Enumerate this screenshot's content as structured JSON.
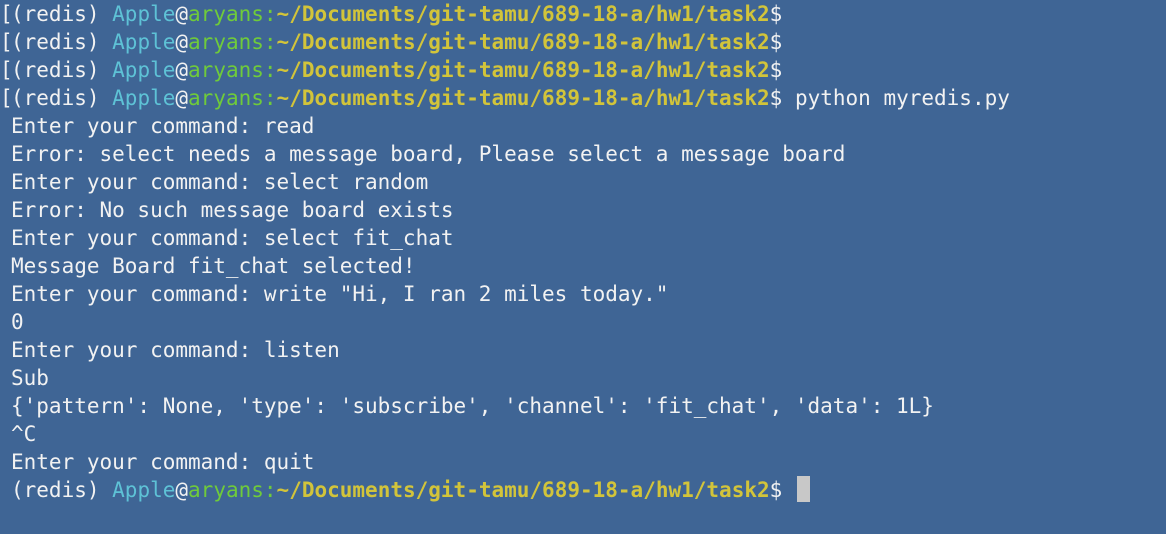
{
  "prompt": {
    "env": "(redis) ",
    "user": "Apple",
    "at": "@",
    "host": "aryans",
    "colon": ":",
    "path": "~/Documents/git-tamu/689-18-a/hw1/task2",
    "dollar": "$",
    "bracket": "["
  },
  "prompt_commands": [
    "",
    "",
    "",
    " python myredis.py",
    " "
  ],
  "output": [
    "Enter your command: read",
    "Error: select needs a message board, Please select a message board",
    "Enter your command: select random",
    "Error: No such message board exists",
    "Enter your command: select fit_chat",
    "Message Board fit_chat selected!",
    "Enter your command: write \"Hi, I ran 2 miles today.\"",
    "0",
    "Enter your command: listen",
    "Sub",
    "{'pattern': None, 'type': 'subscribe', 'channel': 'fit_chat', 'data': 1L}",
    "^C",
    "Enter your command: quit"
  ]
}
